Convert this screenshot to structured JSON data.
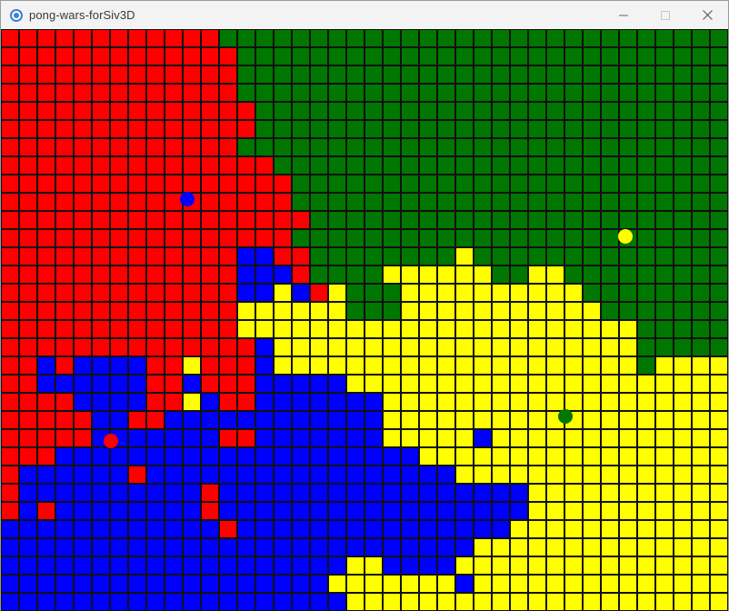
{
  "window": {
    "title": "pong-wars-forSiv3D",
    "icon": "siv3d-app-icon",
    "controls": [
      "minimize-icon",
      "maximize-icon",
      "close-icon"
    ]
  },
  "game": {
    "columns": 40,
    "rows": 32,
    "colors": {
      "R": "#ff0000",
      "G": "#007700",
      "B": "#0000ff",
      "Y": "#ffff00",
      "grid": "#111111"
    },
    "grid": [
      "RRRRRRRRRRRRGGGGGGGGGGGGGGGGGGGGGGGGGGGG",
      "RRRRRRRRRRRRRGGGGGGGGGGGGGGGGGGGGGGGGGGG",
      "RRRRRRRRRRRRRGGGGGGGGGGGGGGGGGGGGGGGGGGG",
      "RRRRRRRRRRRRRGGGGGGGGGGGGGGGGGGGGGGGGGGG",
      "RRRRRRRRRRRRRRGGGGGGGGGGGGGGGGGGGGGGGGGG",
      "RRRRRRRRRRRRRRGGGGGGGGGGGGGGGGGGGGGGGGGG",
      "RRRRRRRRRRRRRGGGGGGGGGGGGGGGGGGGGGGGGGGG",
      "RRRRRRRRRRRRRRRGGGGGGGGGGGGGGGGGGGGGGGGG",
      "RRRRRRRRRRRRRRRRGGGGGGGGGGGGGGGGGGGGGGGG",
      "RRRRRRRRRRRRRRRRGGGGGGGGGGGGGGGGGGGGGGGG",
      "RRRRRRRRRRRRRRRRRGGGGGGGGGGGGGGGGGGGGGGG",
      "RRRRRRRRRRRRRRRRGGGGGGGGGGGGGGGGGGGGGGGG",
      "RRRRRRRRRRRRRBBRRGGGGGGGGYGGGGGGGGGGGGGG",
      "RRRRRRRRRRRRRBBBRGGGGYYYYYYGGYYGGGGGGGGG",
      "RRRRRRRRRRRRRBBYBRYGGGYYYYYYYYYYGGGGGGGG",
      "RRRRRRRRRRRRRYYYYYYGGGYYYYYYYYYYYGGGGGGG",
      "RRRRRRRRRRRRRYYYYYYYYYYYYYYYYYYYYYYGGGGG",
      "RRRRRRRRRRRRRRBYYYYYYYYYYYYYYYYYYYYGGGGG",
      "RRBRBBBBRRYRRRBYYYYYYYYYYYYYYYYYYYYGYYYYG",
      "RRBBBBBBRRBRRRBBBBBYYYYYYYYYYYYYYYYYYYYY",
      "RRRRBBBBRRYBRRBBBBBBBYYYYYYYYYYYYYYYYYYY",
      "RRRRRBBRRBBBBBBBBBBBBYYYYYYYYYYYYYYYYYYY",
      "RRRRRBBBBBBBRRBBBBBBBYYYYYBYYYYYYYYYYYYY",
      "RRRBBBBBBBBBBBBBBBBBBBBYYYYYYYYYYYYYYYYY",
      "RBBBBBBRBBBBBBBBBBBBBBBBBYYYYYYYYYYYYYYY",
      "RBBBBBBBBBBRBBBBBBBBBBBBBBBBBYYYYYYYYYYY",
      "RBRBBBBBBBBRBBBBBBBBBBBBBBBBBYYYYYYYYYYY",
      "BBBBBBBBBBBBRBBBBBBBBBBBBBBBYYYYYYYYYYYY",
      "BBBBBBBBBBBBBBBBBBBBBBBBBBYYYYYYYYYYYYYY",
      "BBBBBBBBBBBBBBBBBBBYYBBBBYYYYYYYYYYYYYYY",
      "BBBBBBBBBBBBBBBBBBYYYYYYYBYYYYYYYYYYYYYY",
      "BBBBBBBBBBBBBBBBBBBYYYYYYYYYYYYYYYYYYYYY"
    ],
    "balls": [
      {
        "team": "blue",
        "color": "#0000ff",
        "col": 10.25,
        "row": 9.35
      },
      {
        "team": "yellow",
        "color": "#ffff00",
        "col": 34.35,
        "row": 11.4
      },
      {
        "team": "green",
        "color": "#007700",
        "col": 31.05,
        "row": 21.3
      },
      {
        "team": "red",
        "color": "#ff0000",
        "col": 6.05,
        "row": 22.65
      }
    ]
  }
}
